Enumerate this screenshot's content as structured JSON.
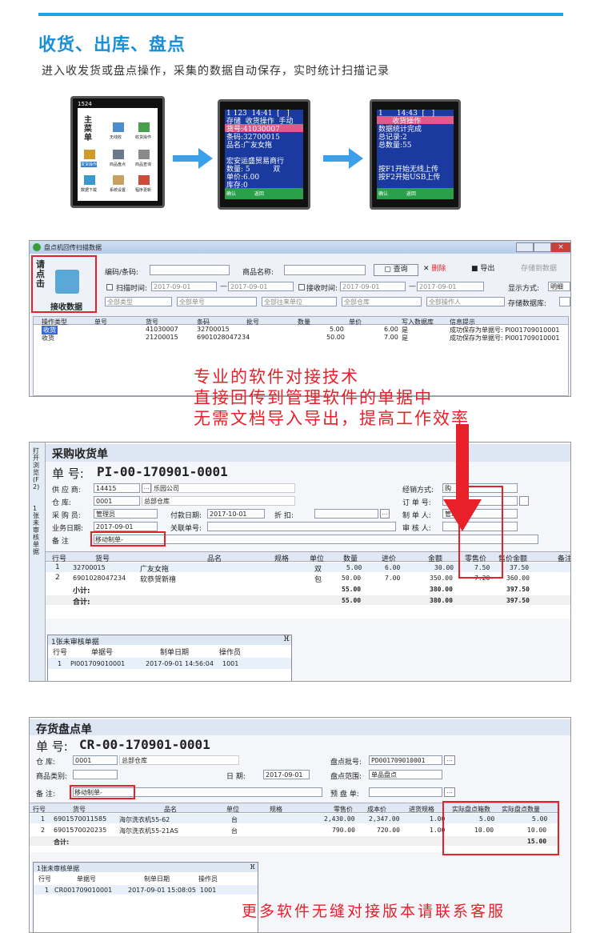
{
  "section": {
    "title": "收货、出库、盘点",
    "subtitle": "进入收发货或盘点操作，采集的数据自动保存，实时统计扫描记录"
  },
  "phone1": {
    "status_time": "1524",
    "menu_title": "主\n菜\n单",
    "icons": [
      "无线收",
      "收货操作",
      "发货操作",
      "商品盘点",
      "商品查询",
      "数据下载",
      "系统设置",
      "程序更新"
    ]
  },
  "phone2": {
    "lines": "1 123  14:41  [   ]\n存储  收货操作  手动\n货号:41030007\n条码:32700015\n品名:广友女拖\n\n宏安运盛贸易商行\n数量: 5          双\n单价:6.00\n库存:0",
    "footer": "确认            返回"
  },
  "phone3": {
    "lines": "1      14:43  [   ]\n      收货操作\n数据统计完成\n总记录:2\n总数量:55\n\n\n按F1开始无线上传\n按F2开始USB上传",
    "footer": "确认            返回"
  },
  "collector": {
    "window_title": "盘点机回传扫描数据",
    "left_panel": {
      "label1": "请\n点\n击",
      "label2": "接收数据"
    },
    "barcode_label": "编码/条码:",
    "product_name_label": "商品名称:",
    "btn_query": "查询",
    "btn_delete": "删除",
    "btn_export": "导出",
    "btn_store": "存储到数据",
    "scan_time_label": "扫描时间:",
    "scan_from": "2017-09-01",
    "scan_to": "2017-09-01",
    "recv_time_label": "接收时间:",
    "recv_from": "2017-09-01",
    "recv_to": "2017-09-01",
    "display_mode_label": "显示方式:",
    "display_mode_value": "明细",
    "filters": [
      "全部类型",
      "全部单号",
      "全部往来单位",
      "全部仓库",
      "全部操作人"
    ],
    "store_db_label": "存储数据库:",
    "columns": [
      "操作类型",
      "单号",
      "货号",
      "条码",
      "批号",
      "数量",
      "单价",
      "写入数据库",
      "信息提示"
    ],
    "rows": [
      [
        "收货",
        "",
        "41030007",
        "32700015",
        "",
        "5.00",
        "6.00",
        "是",
        "成功保存为单据号: PI001709010001"
      ],
      [
        "收货",
        "",
        "21200015",
        "6901028047234",
        "",
        "50.00",
        "7.00",
        "是",
        "成功保存为单据号: PI001709010001"
      ]
    ]
  },
  "promo": {
    "line1": "专业的软件对接技术",
    "line2": "直接回传到管理软件的单据中",
    "line3": "无需文档导入导出，提高工作效率"
  },
  "purchase": {
    "side_tabs": [
      "打开浏览(F2)",
      "1张未审核单据"
    ],
    "title": "采购收货单",
    "doc_no_label": "单  号:",
    "doc_no": "PI-00-170901-0001",
    "supplier_label": "供 应 商:",
    "supplier_code": "14415",
    "supplier_name": "乐园公司",
    "warehouse_label": "仓    库:",
    "warehouse_code": "0001",
    "warehouse_name": "总部仓库",
    "buyer_label": "采 购 员:",
    "buyer": "管理员",
    "pay_date_label": "付款日期:",
    "pay_date": "2017-10-01",
    "discount_label": "折      扣:",
    "biz_date_label": "业务日期:",
    "biz_date": "2017-09-01",
    "related_label": "关联单号:",
    "note_label": "备    注",
    "note": "移动制单-",
    "sale_mode_label": "经销方式:",
    "sale_mode": "购",
    "order_no_label": "订 单 号:",
    "maker_label": "制 单 人:",
    "maker": "管理员",
    "auditor_label": "审 核 人:",
    "columns": [
      "行号",
      "货号",
      "品名",
      "规格",
      "单位",
      "数量",
      "进价",
      "金额",
      "零售价",
      "售价金额",
      "备注"
    ],
    "rows": [
      [
        "1",
        "32700015",
        "广友女拖",
        "",
        "双",
        "5.00",
        "6.00",
        "30.00",
        "7.50",
        "37.50"
      ],
      [
        "2",
        "6901028047234",
        "软恭贺新禧",
        "",
        "包",
        "50.00",
        "7.00",
        "350.00",
        "7.20",
        "360.00"
      ]
    ],
    "subtotal_label": "小计:",
    "subtotal": [
      "55.00",
      "380.00",
      "397.50"
    ],
    "total_label": "合计:",
    "total": [
      "55.00",
      "380.00",
      "397.50"
    ],
    "pending": {
      "title": "1张未审核单据",
      "columns": [
        "行号",
        "单据号",
        "制单日期",
        "操作员"
      ],
      "row": [
        "1",
        "PI001709010001",
        "2017-09-01 14:56:04",
        "1001"
      ]
    }
  },
  "inventory": {
    "title": "存货盘点单",
    "doc_no_label": "单  号:",
    "doc_no": "CR-00-170901-0001",
    "warehouse_label": "仓    库:",
    "warehouse_code": "0001",
    "warehouse_name": "总部仓库",
    "category_label": "商品类别:",
    "date_label": "日    期:",
    "date": "2017-09-01",
    "note_label": "备    注:",
    "note": "移动制单-",
    "batch_label": "盘点批号:",
    "batch": "PD001709010001",
    "range_label": "盘点范围:",
    "range": "单品盘点",
    "pre_label": "预 盘 单:",
    "columns": [
      "行号",
      "货号",
      "品名",
      "单位",
      "规格",
      "零售价",
      "成本价",
      "进货规格",
      "实际盘点箱数",
      "实际盘点数量"
    ],
    "rows": [
      [
        "1",
        "6901570011585",
        "海尔洗衣机55-62",
        "台",
        "",
        "2,430.00",
        "2,347.00",
        "1.00",
        "5.00",
        "5.00"
      ],
      [
        "2",
        "6901570020235",
        "海尔洗衣机55-21AS",
        "台",
        "",
        "790.00",
        "720.00",
        "1.00",
        "10.00",
        "10.00"
      ]
    ],
    "total_label": "合计:",
    "total": "15.00",
    "pending": {
      "title": "1张未审核单据",
      "columns": [
        "行号",
        "单据号",
        "制单日期",
        "操作员"
      ],
      "row": [
        "1",
        "CR001709010001",
        "2017-09-01 15:08:05",
        "1001"
      ]
    }
  },
  "footer_promo": "更多软件无缝对接版本请联系客服",
  "colors": {
    "accent": "#1a8fd8",
    "red": "#e8202a",
    "phone_bg": "#111111",
    "phone2_hdr": "#e05a8a",
    "arrow": "#3aa0ea"
  }
}
